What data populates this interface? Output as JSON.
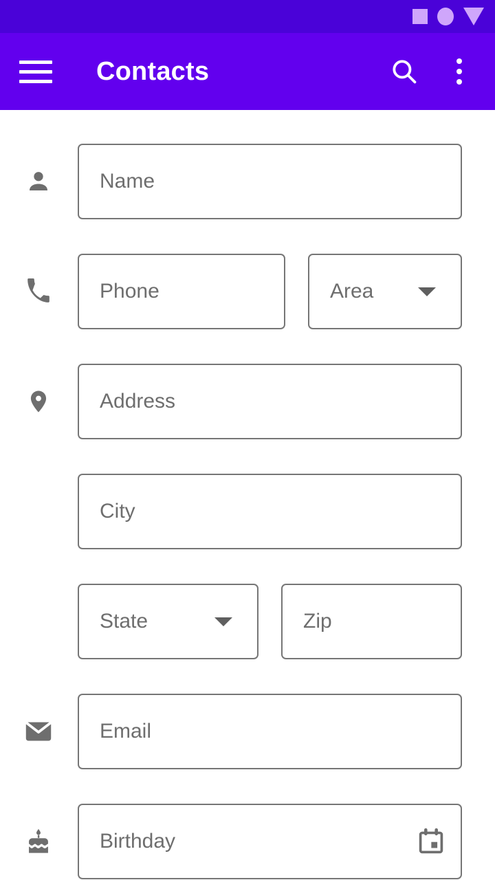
{
  "status_bar": {
    "background": "#4a02d8",
    "icons": [
      "square-placeholder-icon",
      "circle-placeholder-icon",
      "triangle-placeholder-icon"
    ]
  },
  "app_bar": {
    "background": "#6200ee",
    "title": "Contacts",
    "menu_icon": "hamburger-menu-icon",
    "search_icon": "search-icon",
    "overflow_icon": "overflow-menu-icon"
  },
  "form": {
    "fields": {
      "name": {
        "placeholder": "Name",
        "icon": "person-icon"
      },
      "phone": {
        "placeholder": "Phone",
        "icon": "phone-icon"
      },
      "area": {
        "placeholder": "Area",
        "icon": "chevron-down-icon"
      },
      "address": {
        "placeholder": "Address",
        "icon": "location-pin-icon"
      },
      "city": {
        "placeholder": "City"
      },
      "state": {
        "placeholder": "State",
        "icon": "chevron-down-icon"
      },
      "zip": {
        "placeholder": "Zip"
      },
      "email": {
        "placeholder": "Email",
        "icon": "email-icon"
      },
      "birthday": {
        "placeholder": "Birthday",
        "icon": "cake-icon",
        "trailing_icon": "calendar-icon"
      }
    }
  },
  "colors": {
    "primary": "#6200ee",
    "status_bar": "#4a02d8",
    "field_border": "#767676",
    "placeholder_text": "#6e6e6e",
    "icon_gray": "#6e6e6e",
    "page_background": "#ffffff"
  }
}
